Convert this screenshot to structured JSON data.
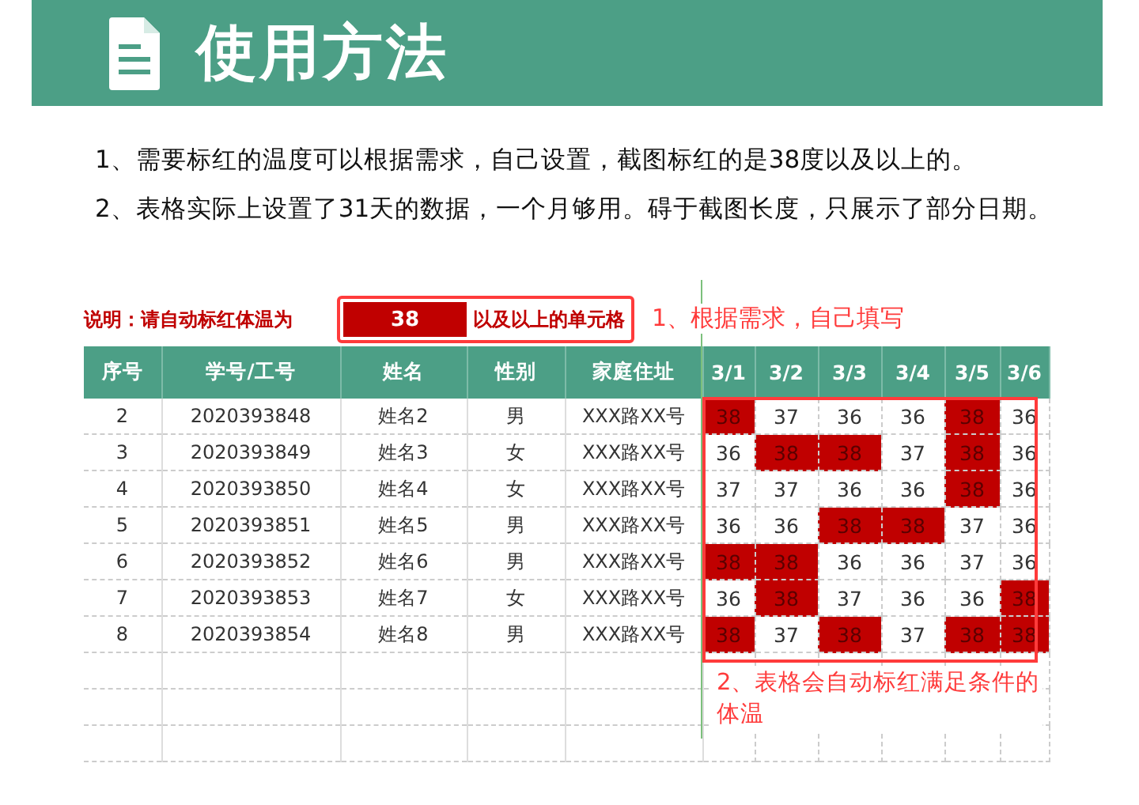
{
  "header": {
    "title": "使用方法"
  },
  "instructions": [
    "1、需要标红的温度可以根据需求，自己设置，截图标红的是38度以及以上的。",
    "2、表格实际上设置了31天的数据，一个月够用。碍于截图长度，只展示了部分日期。"
  ],
  "note": {
    "label": "说明：请自动标红体温为",
    "threshold": "38",
    "suffix": "以及以上的单元格"
  },
  "annotations": [
    "1、根据需求，自己填写",
    "2、表格会自动标红满足条件的体温"
  ],
  "table": {
    "columns": [
      "序号",
      "学号/工号",
      "姓名",
      "性别",
      "家庭住址",
      "3/1",
      "3/2",
      "3/3",
      "3/4",
      "3/5",
      "3/6"
    ],
    "rows": [
      {
        "cells": [
          "2",
          "2020393848",
          "姓名2",
          "男",
          "XXX路XX号"
        ],
        "temps": [
          {
            "value": "38",
            "marked": true
          },
          {
            "value": "37",
            "marked": false
          },
          {
            "value": "36",
            "marked": false
          },
          {
            "value": "36",
            "marked": false
          },
          {
            "value": "38",
            "marked": true
          },
          {
            "value": "36",
            "marked": false
          }
        ]
      },
      {
        "cells": [
          "3",
          "2020393849",
          "姓名3",
          "女",
          "XXX路XX号"
        ],
        "temps": [
          {
            "value": "36",
            "marked": false
          },
          {
            "value": "38",
            "marked": true
          },
          {
            "value": "38",
            "marked": true
          },
          {
            "value": "37",
            "marked": false
          },
          {
            "value": "38",
            "marked": true
          },
          {
            "value": "36",
            "marked": false
          }
        ]
      },
      {
        "cells": [
          "4",
          "2020393850",
          "姓名4",
          "女",
          "XXX路XX号"
        ],
        "temps": [
          {
            "value": "37",
            "marked": false
          },
          {
            "value": "37",
            "marked": false
          },
          {
            "value": "36",
            "marked": false
          },
          {
            "value": "36",
            "marked": false
          },
          {
            "value": "38",
            "marked": true
          },
          {
            "value": "36",
            "marked": false
          }
        ]
      },
      {
        "cells": [
          "5",
          "2020393851",
          "姓名5",
          "男",
          "XXX路XX号"
        ],
        "temps": [
          {
            "value": "36",
            "marked": false
          },
          {
            "value": "36",
            "marked": false
          },
          {
            "value": "38",
            "marked": true
          },
          {
            "value": "38",
            "marked": true
          },
          {
            "value": "37",
            "marked": false
          },
          {
            "value": "36",
            "marked": false
          }
        ]
      },
      {
        "cells": [
          "6",
          "2020393852",
          "姓名6",
          "男",
          "XXX路XX号"
        ],
        "temps": [
          {
            "value": "38",
            "marked": true
          },
          {
            "value": "38",
            "marked": true
          },
          {
            "value": "36",
            "marked": false
          },
          {
            "value": "36",
            "marked": false
          },
          {
            "value": "37",
            "marked": false
          },
          {
            "value": "36",
            "marked": false
          }
        ]
      },
      {
        "cells": [
          "7",
          "2020393853",
          "姓名7",
          "女",
          "XXX路XX号"
        ],
        "temps": [
          {
            "value": "36",
            "marked": false
          },
          {
            "value": "38",
            "marked": true
          },
          {
            "value": "37",
            "marked": false
          },
          {
            "value": "36",
            "marked": false
          },
          {
            "value": "36",
            "marked": false
          },
          {
            "value": "38",
            "marked": true
          }
        ]
      },
      {
        "cells": [
          "8",
          "2020393854",
          "姓名8",
          "男",
          "XXX路XX号"
        ],
        "temps": [
          {
            "value": "38",
            "marked": true
          },
          {
            "value": "37",
            "marked": false
          },
          {
            "value": "38",
            "marked": true
          },
          {
            "value": "37",
            "marked": false
          },
          {
            "value": "38",
            "marked": true
          },
          {
            "value": "38",
            "marked": true
          }
        ]
      }
    ]
  }
}
